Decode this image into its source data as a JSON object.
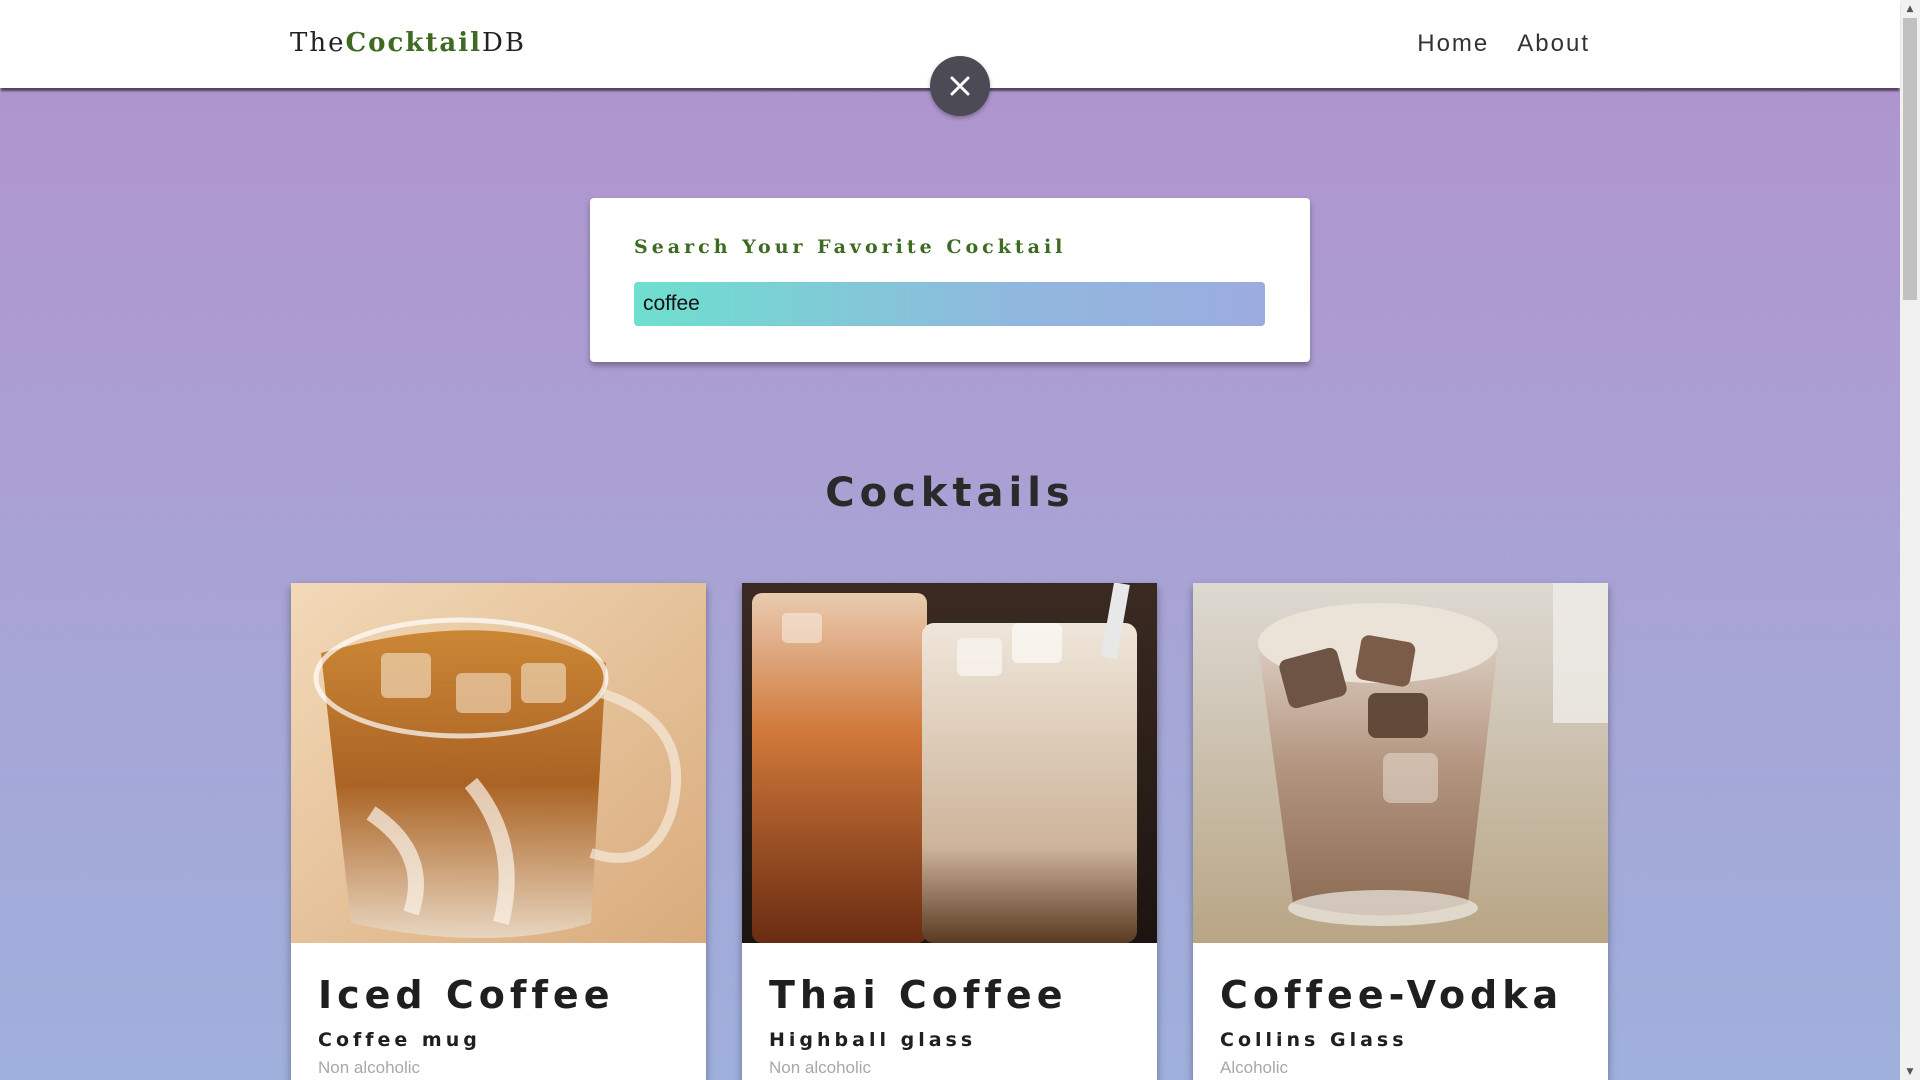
{
  "navbar": {
    "logo_prefix": "The",
    "logo_accent": "Cocktail",
    "logo_suffix": "DB",
    "links": [
      {
        "label": "Home"
      },
      {
        "label": "About"
      }
    ]
  },
  "close_button": {
    "icon": "close-icon"
  },
  "search": {
    "label": "Search Your Favorite Cocktail",
    "value": "coffee"
  },
  "section_title": "Cocktails",
  "cocktails": [
    {
      "name": "Iced Coffee",
      "glass": "Coffee mug",
      "alcoholic": "Non alcoholic"
    },
    {
      "name": "Thai Coffee",
      "glass": "Highball glass",
      "alcoholic": "Non alcoholic"
    },
    {
      "name": "Coffee-Vodka",
      "glass": "Collins Glass",
      "alcoholic": "Alcoholic"
    }
  ],
  "colors": {
    "accent": "#3d6b22",
    "background_top": "#b092cc",
    "background_bottom": "#9fb0dc",
    "close_button": "#4b4a55"
  }
}
